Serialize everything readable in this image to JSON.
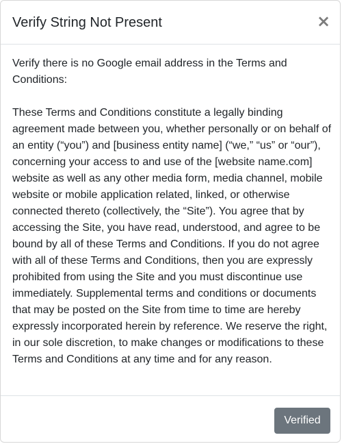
{
  "modal": {
    "title": "Verify String Not Present",
    "close_symbol": "×",
    "close_icon": "close-icon"
  },
  "body": {
    "instruction": "Verify there is no Google email address in the Terms and Conditions:",
    "terms_text": "These Terms and Conditions constitute a legally binding agreement made between you, whether personally or on behalf of an entity (“you”) and [business entity name] (“we,” “us” or “our”), concerning your access to and use of the [website name.com] website as well as any other media form, media channel, mobile website or mobile application related, linked, or otherwise connected thereto (collectively, the “Site”). You agree that by accessing the Site, you have read, understood, and agree to be bound by all of these Terms and Conditions. If you do not agree with all of these Terms and Conditions, then you are expressly prohibited from using the Site and you must discontinue use immediately. Supplemental terms and conditions or documents that may be posted on the Site from time to time are hereby expressly incorporated herein by reference. We reserve the right, in our sole discretion, to make changes or modifications to these Terms and Conditions at any time and for any reason."
  },
  "footer": {
    "verified_label": "Verified"
  },
  "colors": {
    "button_secondary": "#6c757d",
    "close_icon": "#7c7c7c",
    "divider": "#dee2e6",
    "text": "#212529"
  }
}
